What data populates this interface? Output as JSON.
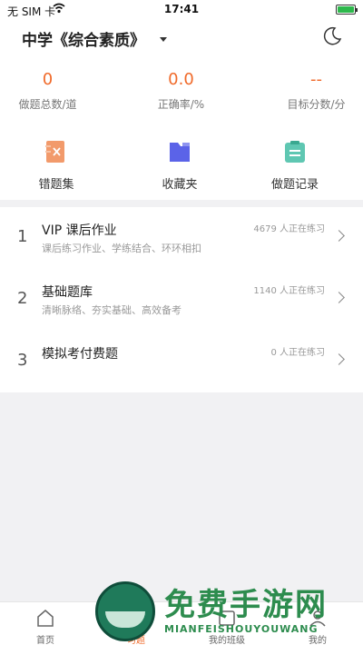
{
  "status_bar": {
    "carrier": "无 SIM 卡",
    "time": "17:41"
  },
  "header": {
    "title": "中学《综合素质》"
  },
  "stats": [
    {
      "value": "0",
      "label": "做题总数/道"
    },
    {
      "value": "0.0",
      "label": "正确率/%"
    },
    {
      "value": "--",
      "label": "目标分数/分"
    }
  ],
  "tools": [
    {
      "label": "错题集",
      "icon": "wrong-questions-icon",
      "color": "#f29a6b"
    },
    {
      "label": "收藏夹",
      "icon": "folder-icon",
      "color": "#5b63e8"
    },
    {
      "label": "做题记录",
      "icon": "clipboard-icon",
      "color": "#5fc7b2"
    }
  ],
  "courses": [
    {
      "index": "1",
      "name": "VIP 课后作业",
      "desc": "课后练习作业、学练结合、环环相扣",
      "count": "4679 人正在练习"
    },
    {
      "index": "2",
      "name": "基础题库",
      "desc": "清晰脉络、夯实基础、高效备考",
      "count": "1140 人正在练习"
    },
    {
      "index": "3",
      "name": "模拟考付费题",
      "desc": "",
      "count": "0 人正在练习"
    }
  ],
  "tabs": [
    {
      "label": "首页"
    },
    {
      "label": "习题"
    },
    {
      "label": "我的班级"
    },
    {
      "label": "我的"
    }
  ],
  "watermark": {
    "cn": "免费手游网",
    "en": "MIANFEISHOUYOUWANG"
  },
  "colors": {
    "accent": "#f06a2a"
  }
}
